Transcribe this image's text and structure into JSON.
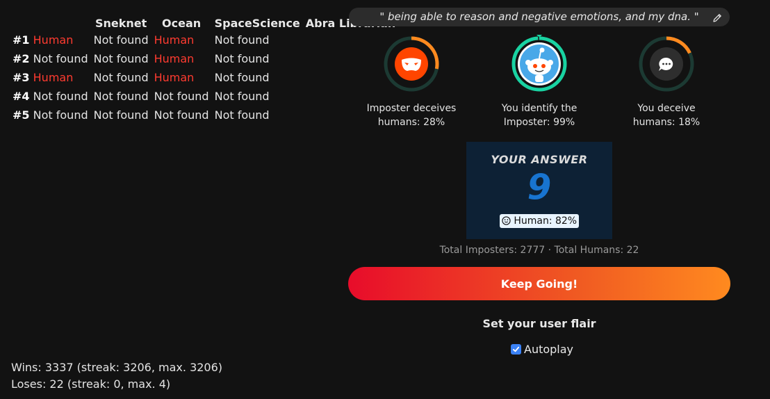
{
  "results": {
    "headers": [
      "",
      "Sneknet",
      "Ocean",
      "SpaceScience",
      "Abra Librarian"
    ],
    "rows": [
      {
        "rank": "#1",
        "cells": [
          "Human",
          "Not found",
          "Human",
          "Not found"
        ]
      },
      {
        "rank": "#2",
        "cells": [
          "Not found",
          "Not found",
          "Human",
          "Not found"
        ]
      },
      {
        "rank": "#3",
        "cells": [
          "Human",
          "Not found",
          "Human",
          "Not found"
        ]
      },
      {
        "rank": "#4",
        "cells": [
          "Not found",
          "Not found",
          "Not found",
          "Not found"
        ]
      },
      {
        "rank": "#5",
        "cells": [
          "Not found",
          "Not found",
          "Not found",
          "Not found"
        ]
      }
    ]
  },
  "stats": {
    "wins": "Wins: 3337 (streak: 3206, max. 3206)",
    "loses": "Loses: 22 (streak: 0, max. 4)"
  },
  "quote": {
    "text": "\" being able to reason and negative emotions, and my dna. \"",
    "edit_icon": "pencil-icon"
  },
  "rings": [
    {
      "id": "imposter-deceives",
      "line1": "Imposter deceives",
      "line2": "humans: 28%",
      "percent": 28,
      "color": "#ff8a1f",
      "track": "#1c3a33",
      "icon": "mask-icon"
    },
    {
      "id": "you-identify",
      "line1": "You identify the",
      "line2": "Imposter: 99%",
      "percent": 99,
      "color": "#19d3a2",
      "track": "#1c3a33",
      "icon": "snoo-avatar-icon"
    },
    {
      "id": "you-deceive",
      "line1": "You deceive",
      "line2": "humans: 18%",
      "percent": 18,
      "color": "#ff8a1f",
      "track": "#1c3a33",
      "icon": "chat-bubble-icon"
    }
  ],
  "answer": {
    "header": "YOUR ANSWER",
    "number": "9",
    "badge": "Human: 82%",
    "badge_icon": "smiley-icon"
  },
  "totals": "Total Imposters: 2777 · Total Humans: 22",
  "keep_going": "Keep Going!",
  "flair": "Set your user flair",
  "autoplay": {
    "label": "Autoplay",
    "checked": true
  },
  "colors": {
    "human": "#ff3b30",
    "answer_bg": "#0d2135",
    "answer_num": "#1874d0"
  }
}
